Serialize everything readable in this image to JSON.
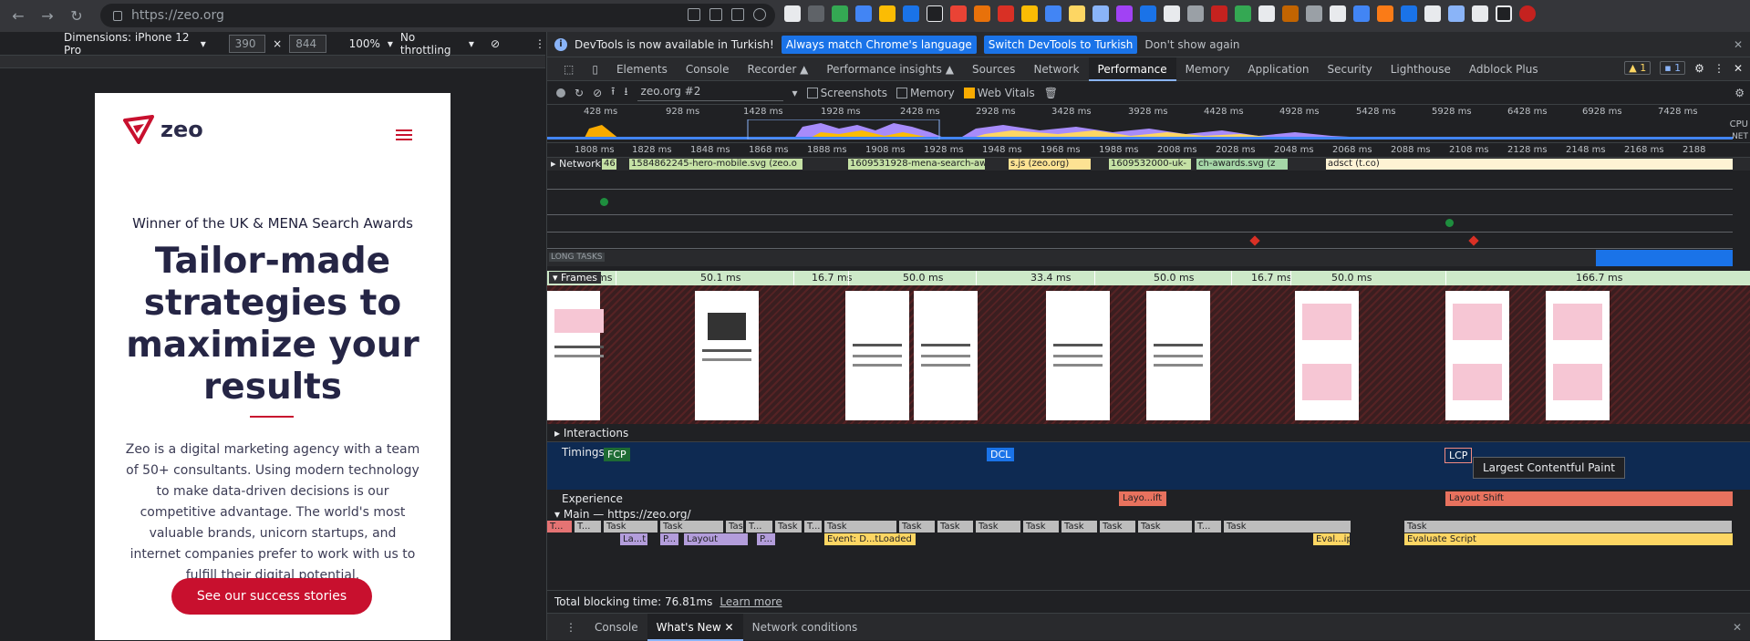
{
  "browser": {
    "url": "https://zeo.org"
  },
  "device_toolbar": {
    "dimensions_label": "Dimensions: iPhone 12 Pro",
    "width": "390",
    "height": "844",
    "zoom": "100%",
    "throttling": "No throttling"
  },
  "page": {
    "logo_text": "zeo",
    "award": "Winner of the UK & MENA Search Awards",
    "headline_lines": [
      "Tailor-made",
      "strategies to",
      "maximize your",
      "results"
    ],
    "description": "Zeo is a digital marketing agency with a team of 50+ consultants. Using modern technology to make data-driven decisions is our competitive advantage. The world's most valuable brands, unicorn startups, and internet companies prefer to work with us to fulfill their digital potential.",
    "cta": "See our success stories",
    "brand_color": "#c8102e"
  },
  "infobar": {
    "message": "DevTools is now available in Turkish!",
    "btn_match": "Always match Chrome's language",
    "btn_switch": "Switch DevTools to Turkish",
    "dont_show": "Don't show again"
  },
  "tabs": [
    "Elements",
    "Console",
    "Recorder ▲",
    "Performance insights ▲",
    "Sources",
    "Network",
    "Performance",
    "Memory",
    "Application",
    "Security",
    "Lighthouse",
    "Adblock Plus"
  ],
  "active_tab": "Performance",
  "issues": {
    "warnings": "1",
    "messages": "1"
  },
  "perf_toolbar": {
    "profile": "zeo.org #2",
    "screenshots": "Screenshots",
    "memory": "Memory",
    "web_vitals": "Web Vitals"
  },
  "overview_ticks": [
    "428 ms",
    "928 ms",
    "1428 ms",
    "1928 ms",
    "2428 ms",
    "2928 ms",
    "3428 ms",
    "3928 ms",
    "4428 ms",
    "4928 ms",
    "5428 ms",
    "5928 ms",
    "6428 ms",
    "6928 ms",
    "7428 ms"
  ],
  "overview_labels": {
    "cpu": "CPU",
    "net": "NET"
  },
  "ruler_ticks": [
    "1808 ms",
    "1828 ms",
    "1848 ms",
    "1868 ms",
    "1888 ms",
    "1908 ms",
    "1928 ms",
    "1948 ms",
    "1968 ms",
    "1988 ms",
    "2008 ms",
    "2028 ms",
    "2048 ms",
    "2068 ms",
    "2088 ms",
    "2108 ms",
    "2128 ms",
    "2148 ms",
    "2168 ms",
    "2188"
  ],
  "network": {
    "label": "Network",
    "requests": [
      {
        "text": "46",
        "color": "#c5e1a5"
      },
      {
        "text": "1584862245-hero-mobile.svg (zeo.o",
        "color": "#c5e1a5"
      },
      {
        "text": "1609531928-mena-search-aw",
        "color": "#c5e1a5"
      },
      {
        "text": "s.js (zeo.org)",
        "color": "#fde293"
      },
      {
        "text": "1609532000-uk-",
        "color": "#c5e1a5"
      },
      {
        "text": "ch-awards.svg (z",
        "color": "#a5d6a7"
      },
      {
        "text": "adsct (t.co)",
        "color": "#fef3d4"
      }
    ]
  },
  "long_tasks_label": "LONG TASKS",
  "frames": {
    "label": "Frames",
    "durations": [
      "ms",
      "50.1 ms",
      "16.7 ms",
      "50.0 ms",
      "33.4 ms",
      "50.0 ms",
      "16.7 ms",
      "50.0 ms",
      "166.7 ms"
    ]
  },
  "sections": {
    "interactions": "Interactions",
    "timings": "Timings",
    "experience": "Experience",
    "main": "Main — https://zeo.org/"
  },
  "timings": {
    "fcp": "FCP",
    "dcl": "DCL",
    "lcp": "LCP",
    "tooltip": "Largest Contentful Paint"
  },
  "experience_bars": [
    "Layo...ift",
    "Layout Shift"
  ],
  "tasks": [
    "T...",
    "T...",
    "Task",
    "Task",
    "Task",
    "T...",
    "Task",
    "T...",
    "Task",
    "Task",
    "Task",
    "Task",
    "Task",
    "Task",
    "Task",
    "Task",
    "T...",
    "Task",
    "Task"
  ],
  "subtasks": [
    "La...t",
    "P...",
    "Layout",
    "P...",
    "Event: D...tLoaded",
    "Eval...ipt",
    "Evaluate Script"
  ],
  "summary": {
    "text": "Total blocking time: 76.81ms",
    "link": "Learn more"
  },
  "drawer": {
    "console": "Console",
    "whats_new": "What's New",
    "network_conditions": "Network conditions"
  }
}
